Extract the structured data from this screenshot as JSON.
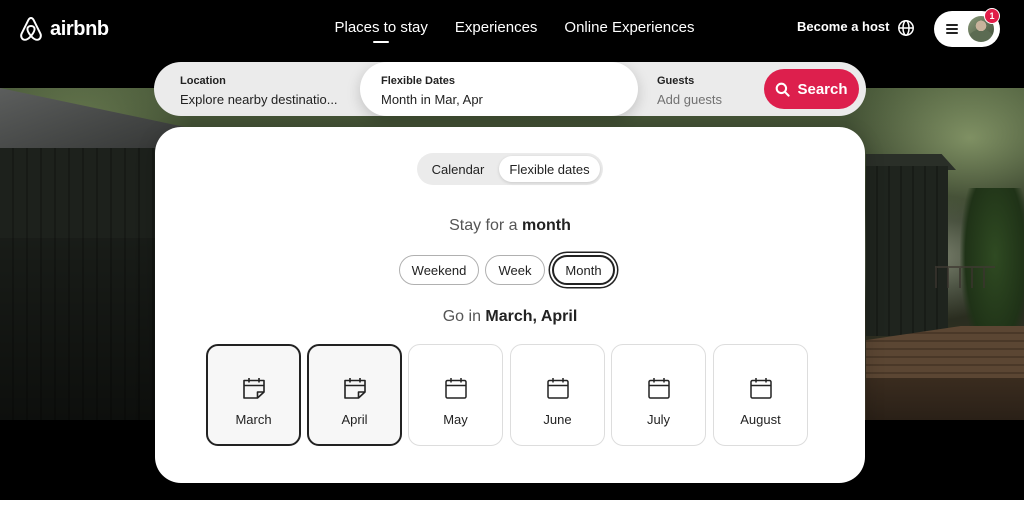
{
  "brand": {
    "name": "airbnb",
    "color": "#ffffff",
    "accent": "#dd1f4d"
  },
  "nav": {
    "items": [
      {
        "label": "Places to stay",
        "active": true
      },
      {
        "label": "Experiences",
        "active": false
      },
      {
        "label": "Online Experiences",
        "active": false
      }
    ]
  },
  "header_right": {
    "become_host": "Become a host",
    "globe_icon": "globe-icon",
    "menu_icon": "hamburger-icon",
    "notification_count": "1"
  },
  "search": {
    "location": {
      "label": "Location",
      "value": "Explore nearby destinatio..."
    },
    "dates": {
      "label": "Flexible Dates",
      "value": "Month in Mar, Apr"
    },
    "guests": {
      "label": "Guests",
      "placeholder": "Add guests"
    },
    "button": {
      "label": "Search",
      "icon": "search-icon"
    }
  },
  "panel": {
    "toggle": {
      "calendar": "Calendar",
      "flexible": "Flexible dates",
      "selected": "Flexible dates"
    },
    "stay": {
      "prefix": "Stay for a ",
      "emphasis": "month"
    },
    "durations": [
      {
        "label": "Weekend",
        "selected": false
      },
      {
        "label": "Week",
        "selected": false
      },
      {
        "label": "Month",
        "selected": true
      }
    ],
    "go": {
      "prefix": "Go in ",
      "emphasis": "March, April"
    },
    "months": [
      {
        "label": "March",
        "selected": true,
        "icon": "calendar-checked-icon"
      },
      {
        "label": "April",
        "selected": true,
        "icon": "calendar-checked-icon"
      },
      {
        "label": "May",
        "selected": false,
        "icon": "calendar-icon"
      },
      {
        "label": "June",
        "selected": false,
        "icon": "calendar-icon"
      },
      {
        "label": "July",
        "selected": false,
        "icon": "calendar-icon"
      },
      {
        "label": "August",
        "selected": false,
        "icon": "calendar-icon"
      }
    ]
  }
}
